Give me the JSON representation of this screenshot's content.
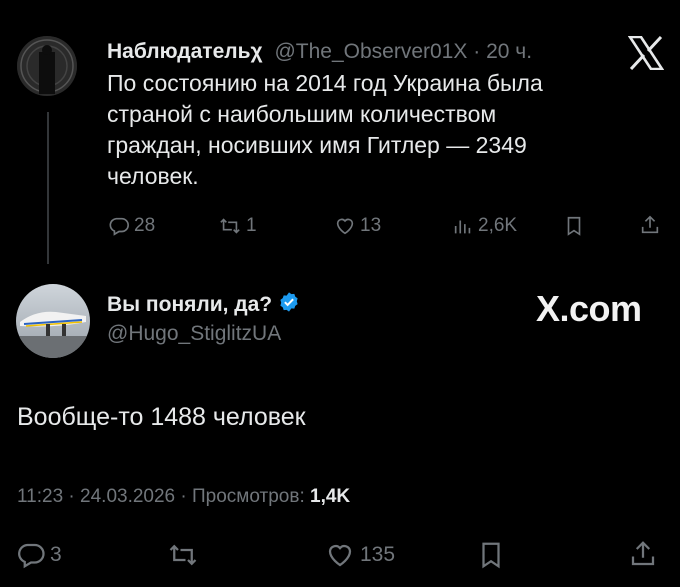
{
  "quoted_tweet": {
    "author_name": "Наблюдательχ",
    "handle": "@The_Observer01X",
    "separator": "·",
    "time": "20 ч.",
    "text_lines": [
      "По состоянию на 2014 год Украина была",
      "страной с наибольшим количеством",
      "граждан, носивших имя Гитлер — 2349",
      "человек."
    ],
    "actions": {
      "replies": "28",
      "reposts": "1",
      "likes": "13",
      "views": "2,6K"
    }
  },
  "main_tweet": {
    "author_name": "Вы поняли, да?",
    "handle": "@Hugo_StiglitzUA",
    "verified": true,
    "text": "Вообще-то 1488 человек",
    "meta": {
      "time": "11:23",
      "sep1": "·",
      "date": "24.03.2026",
      "sep2": "·",
      "views_label": "Просмотров:",
      "views": "1,4K"
    },
    "actions": {
      "replies": "3",
      "likes": "135"
    }
  },
  "brand": {
    "x_logo_text": "X.com"
  },
  "colors": {
    "background": "#000000",
    "text": "#e7e9ea",
    "muted": "#71767b",
    "verified": "#1d9bf0"
  },
  "icons": [
    "x-logo-icon",
    "reply-icon",
    "repost-icon",
    "like-icon",
    "views-icon",
    "bookmark-icon",
    "share-icon",
    "verified-badge-icon"
  ]
}
